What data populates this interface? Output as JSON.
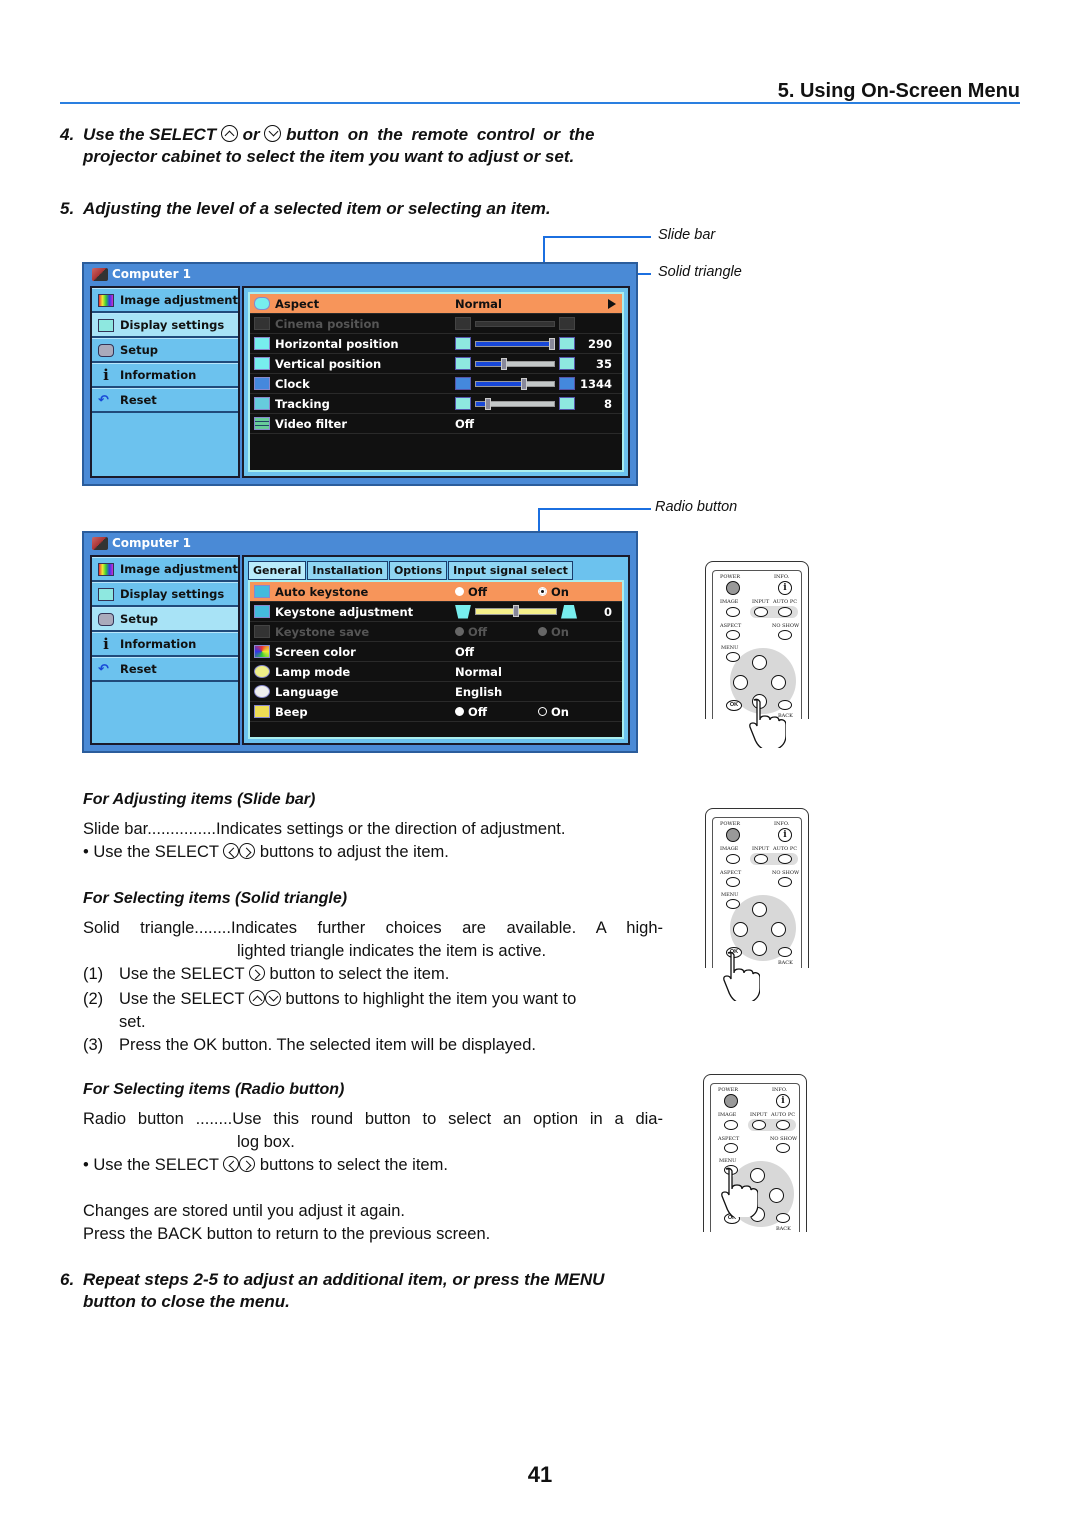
{
  "header": {
    "section_title": "5. Using On-Screen Menu"
  },
  "steps": {
    "step4": {
      "num": "4.",
      "line1_a": "Use the SELECT",
      "line1_b": "or",
      "line1_c": "button on the remote control or the",
      "line2": "projector cabinet to select the item you want to adjust or set.",
      "icons": [
        "select-up-icon",
        "select-down-icon"
      ]
    },
    "step5": {
      "num": "5.",
      "text": "Adjusting the level of a selected item or selecting an item."
    },
    "step6": {
      "num": "6.",
      "line1": "Repeat steps 2-5 to adjust an additional item, or press the MENU",
      "line2": "button to close the menu."
    }
  },
  "callouts": {
    "slide_bar": "Slide bar",
    "solid_triangle": "Solid triangle",
    "radio_button": "Radio button"
  },
  "osd1": {
    "title": "Computer 1",
    "sidebar": [
      {
        "label": "Image adjustment",
        "icon": "image-adjustment-icon"
      },
      {
        "label": "Display settings",
        "icon": "display-settings-icon",
        "active": true
      },
      {
        "label": "Setup",
        "icon": "setup-icon"
      },
      {
        "label": "Information",
        "icon": "information-icon"
      },
      {
        "label": "Reset",
        "icon": "reset-icon"
      }
    ],
    "rows": [
      {
        "label": "Aspect",
        "value": "Normal",
        "type": "select",
        "highlighted": true
      },
      {
        "label": "Cinema position",
        "type": "slider",
        "disabled": true,
        "level": 0
      },
      {
        "label": "Horizontal position",
        "type": "slider",
        "value": "290",
        "level": 0.95
      },
      {
        "label": "Vertical position",
        "type": "slider",
        "value": "35",
        "level": 0.35
      },
      {
        "label": "Clock",
        "type": "slider",
        "value": "1344",
        "level": 0.6
      },
      {
        "label": "Tracking",
        "type": "slider",
        "value": "8",
        "level": 0.15
      },
      {
        "label": "Video filter",
        "value": "Off",
        "type": "text"
      }
    ]
  },
  "osd2": {
    "title": "Computer 1",
    "sidebar": [
      {
        "label": "Image adjustment",
        "icon": "image-adjustment-icon"
      },
      {
        "label": "Display settings",
        "icon": "display-settings-icon"
      },
      {
        "label": "Setup",
        "icon": "setup-icon",
        "active": true
      },
      {
        "label": "Information",
        "icon": "information-icon"
      },
      {
        "label": "Reset",
        "icon": "reset-icon"
      }
    ],
    "tabs": [
      "General",
      "Installation",
      "Options",
      "Input signal select"
    ],
    "rows": [
      {
        "label": "Auto keystone",
        "type": "radio",
        "options": [
          "Off",
          "On"
        ],
        "selected": "On",
        "highlighted": true
      },
      {
        "label": "Keystone adjustment",
        "type": "slider",
        "value": "0",
        "level": 0.5
      },
      {
        "label": "Keystone save",
        "type": "radio",
        "options": [
          "Off",
          "On"
        ],
        "disabled": true
      },
      {
        "label": "Screen color",
        "value": "Off",
        "type": "text"
      },
      {
        "label": "Lamp mode",
        "value": "Normal",
        "type": "text"
      },
      {
        "label": "Language",
        "value": "English",
        "type": "text"
      },
      {
        "label": "Beep",
        "type": "radio",
        "options": [
          "Off",
          "On"
        ],
        "selected": "Off"
      }
    ]
  },
  "remote": {
    "labels": {
      "power": "POWER",
      "info": "INFO.",
      "image": "IMAGE",
      "input": "INPUT",
      "auto_pc": "AUTO PC",
      "aspect": "ASPECT",
      "no_show": "NO SHOW",
      "menu": "MENU",
      "ok": "OK",
      "back": "BACK"
    }
  },
  "slide_bar_section": {
    "heading": "For Adjusting items (Slide bar)",
    "term": "Slide bar",
    "dots": "...............",
    "definition": "Indicates settings or the direction of adjustment.",
    "bullet_a": "• Use the SELECT",
    "bullet_b": "buttons to adjust the item."
  },
  "solid_triangle_section": {
    "heading": "For Selecting items (Solid triangle)",
    "term": "Solid triangle",
    "dots": "........",
    "definition_line1": "Indicates further choices are available. A high-",
    "definition_line2": "lighted triangle indicates the item is active.",
    "list": [
      {
        "n": "(1)",
        "a": "Use the SELECT",
        "b": "button to select the item."
      },
      {
        "n": "(2)",
        "a": "Use the SELECT",
        "b": "buttons to highlight the item you want to",
        "c": "set."
      },
      {
        "n": "(3)",
        "a": "Press the OK button. The selected item will be displayed."
      }
    ]
  },
  "radio_section": {
    "heading": "For Selecting items (Radio button)",
    "term": "Radio button",
    "dots": " ........",
    "definition_line1": "Use this round button to select an option in a dia-",
    "definition_line2": "log box.",
    "bullet_a": "• Use the SELECT",
    "bullet_b": "buttons to select the item.",
    "note1": "Changes are stored until you adjust it again.",
    "note2": "Press the BACK button to return to the previous screen."
  },
  "page_number": "41"
}
